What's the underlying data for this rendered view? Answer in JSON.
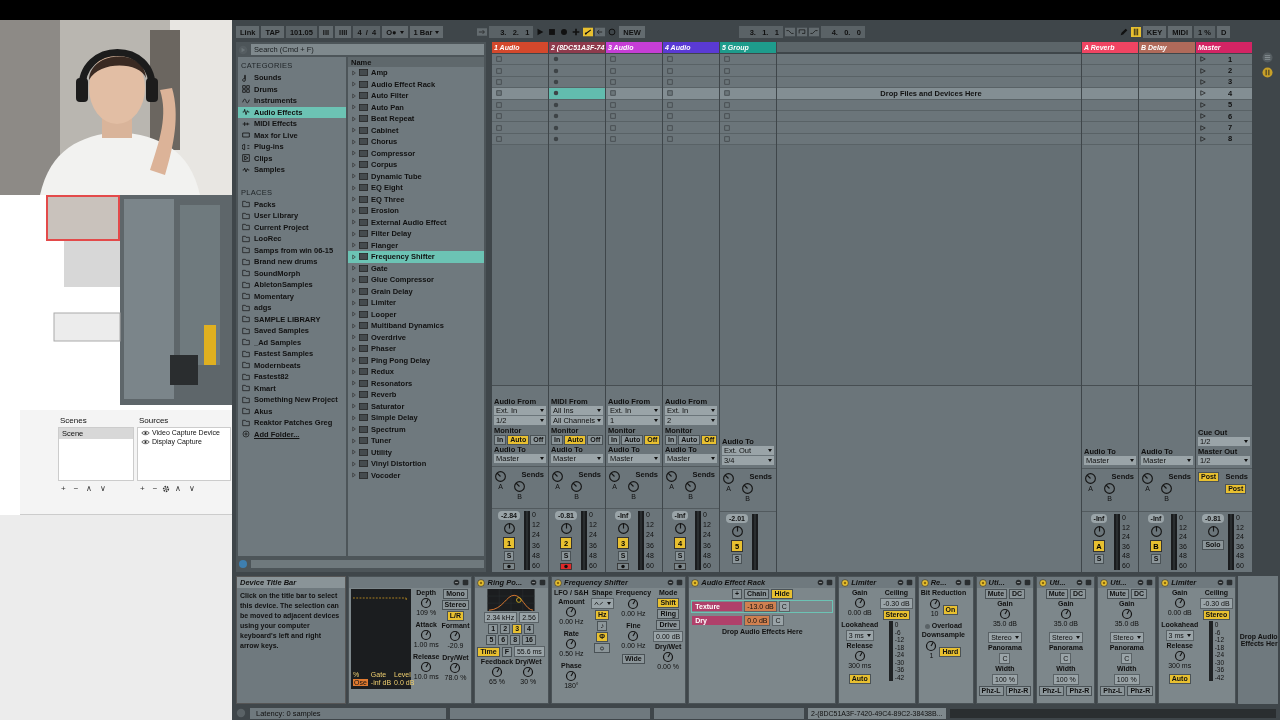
{
  "obs": {
    "scenes_title": "Scenes",
    "sources_title": "Sources",
    "scenes": [
      {
        "label": "Scene",
        "selected": true
      }
    ],
    "sources": [
      {
        "label": "Video Capture Device",
        "visible": true
      },
      {
        "label": "Display Capture",
        "visible": true
      }
    ],
    "scene_buttons": [
      "+",
      "−",
      "∧",
      "∨"
    ],
    "source_buttons": [
      "+",
      "−",
      "∧",
      "∨"
    ]
  },
  "top_bar": {
    "left": [
      {
        "kind": "button",
        "label": "Link"
      },
      {
        "kind": "button",
        "label": "TAP"
      },
      {
        "kind": "display",
        "label": "101.05"
      },
      {
        "kind": "button",
        "label": "III"
      },
      {
        "kind": "button",
        "label": "IIII"
      },
      {
        "kind": "display",
        "label": "4  /  4"
      },
      {
        "kind": "dropdown",
        "label": "O●"
      },
      {
        "kind": "dropdown",
        "label": "1 Bar"
      }
    ],
    "position": "3.   2.   1",
    "automation_arm": true,
    "new": "NEW",
    "loop_start": "3.   1.   1",
    "loop_length": "4.   0.   0",
    "keys_on": true,
    "right": [
      {
        "kind": "button",
        "label": "KEY"
      },
      {
        "kind": "button",
        "label": "MIDI"
      },
      {
        "kind": "display",
        "label": "1 %"
      },
      {
        "kind": "button",
        "label": "D"
      }
    ]
  },
  "browser": {
    "search": {
      "placeholder": "Search (Cmd + F)"
    },
    "categories_title": "CATEGORIES",
    "categories": [
      {
        "label": "Sounds",
        "selected": false
      },
      {
        "label": "Drums",
        "selected": false
      },
      {
        "label": "Instruments",
        "selected": false
      },
      {
        "label": "Audio Effects",
        "selected": true
      },
      {
        "label": "MIDI Effects",
        "selected": false
      },
      {
        "label": "Max for Live",
        "selected": false
      },
      {
        "label": "Plug-ins",
        "selected": false
      },
      {
        "label": "Clips",
        "selected": false
      },
      {
        "label": "Samples",
        "selected": false
      }
    ],
    "places_title": "PLACES",
    "places": [
      "Packs",
      "User Library",
      "Current Project",
      "LooRec",
      "Samps from win 06-15",
      "Brand new drums",
      "SoundMorph",
      "AbletonSamples",
      "Momentary",
      "adgs",
      "SAMPLE LIBRARY",
      "Saved Samples",
      "_Ad Samples",
      "Fastest Samples",
      "Modernbeats",
      "Fastest82",
      "Kmart",
      "Something New Project",
      "Akus",
      "Reaktor Patches Greg"
    ],
    "add_folder": "Add Folder...",
    "column": "Name",
    "items": [
      {
        "label": "Amp",
        "selected": false
      },
      {
        "label": "Audio Effect Rack",
        "selected": false
      },
      {
        "label": "Auto Filter",
        "selected": false
      },
      {
        "label": "Auto Pan",
        "selected": false
      },
      {
        "label": "Beat Repeat",
        "selected": false
      },
      {
        "label": "Cabinet",
        "selected": false
      },
      {
        "label": "Chorus",
        "selected": false
      },
      {
        "label": "Compressor",
        "selected": false
      },
      {
        "label": "Corpus",
        "selected": false
      },
      {
        "label": "Dynamic Tube",
        "selected": false
      },
      {
        "label": "EQ Eight",
        "selected": false
      },
      {
        "label": "EQ Three",
        "selected": false
      },
      {
        "label": "Erosion",
        "selected": false
      },
      {
        "label": "External Audio Effect",
        "selected": false
      },
      {
        "label": "Filter Delay",
        "selected": false
      },
      {
        "label": "Flanger",
        "selected": false
      },
      {
        "label": "Frequency Shifter",
        "selected": true
      },
      {
        "label": "Gate",
        "selected": false
      },
      {
        "label": "Glue Compressor",
        "selected": false
      },
      {
        "label": "Grain Delay",
        "selected": false
      },
      {
        "label": "Limiter",
        "selected": false
      },
      {
        "label": "Looper",
        "selected": false
      },
      {
        "label": "Multiband Dynamics",
        "selected": false
      },
      {
        "label": "Overdrive",
        "selected": false
      },
      {
        "label": "Phaser",
        "selected": false
      },
      {
        "label": "Ping Pong Delay",
        "selected": false
      },
      {
        "label": "Redux",
        "selected": false
      },
      {
        "label": "Resonators",
        "selected": false
      },
      {
        "label": "Reverb",
        "selected": false
      },
      {
        "label": "Saturator",
        "selected": false
      },
      {
        "label": "Simple Delay",
        "selected": false
      },
      {
        "label": "Spectrum",
        "selected": false
      },
      {
        "label": "Tuner",
        "selected": false
      },
      {
        "label": "Utility",
        "selected": false
      },
      {
        "label": "Vinyl Distortion",
        "selected": false
      },
      {
        "label": "Vocoder",
        "selected": false
      }
    ]
  },
  "session": {
    "drop_hint": "Drop Files and Devices Here",
    "tracks": [
      {
        "name": "1 Audio",
        "color": "#d4482c",
        "kind": "audio",
        "armed": false,
        "focused": false,
        "routing": [
          {
            "kind": "dropdown",
            "label": "Audio From",
            "value": "Ext. In",
            "channel": "1/2"
          },
          {
            "kind": "monitor",
            "label": "Monitor",
            "options": [
              {
                "label": "In",
                "on": false
              },
              {
                "label": "Auto",
                "on": true
              },
              {
                "label": "Off",
                "on": false
              }
            ]
          },
          {
            "kind": "dropdown",
            "label": "Audio To",
            "value": "Master"
          }
        ],
        "sends": {
          "label": "Sends",
          "knobs": [
            "A",
            "B"
          ]
        },
        "volume": "-2.84",
        "number": "1",
        "active": true,
        "solo": "S",
        "arm": false,
        "scale": [
          "0",
          "12",
          "24",
          "36",
          "48",
          "60"
        ]
      },
      {
        "name": "2 (8DC51A3F-74",
        "color": "#8e3a4c",
        "kind": "midi",
        "armed": true,
        "focused": true,
        "routing": [
          {
            "kind": "dropdown",
            "label": "MIDI From",
            "value": "All Ins",
            "channel": "All Channels"
          },
          {
            "kind": "monitor",
            "label": "Monitor",
            "options": [
              {
                "label": "In",
                "on": false
              },
              {
                "label": "Auto",
                "on": true
              },
              {
                "label": "Off",
                "on": false
              }
            ]
          },
          {
            "kind": "dropdown",
            "label": "Audio To",
            "value": "Master"
          }
        ],
        "sends": {
          "label": "Sends",
          "knobs": [
            "A",
            "B"
          ]
        },
        "volume": "-0.81",
        "number": "2",
        "active": true,
        "solo": "S",
        "arm": true,
        "scale": [
          "0",
          "12",
          "24",
          "36",
          "48",
          "60"
        ]
      },
      {
        "name": "3 Audio",
        "color": "#c63ed6",
        "kind": "audio",
        "armed": false,
        "focused": false,
        "routing": [
          {
            "kind": "dropdown",
            "label": "Audio From",
            "value": "Ext. In",
            "channel": "1"
          },
          {
            "kind": "monitor",
            "label": "Monitor",
            "options": [
              {
                "label": "In",
                "on": false
              },
              {
                "label": "Auto",
                "on": false
              },
              {
                "label": "Off",
                "on": true
              }
            ]
          },
          {
            "kind": "dropdown",
            "label": "Audio To",
            "value": "Master"
          }
        ],
        "sends": {
          "label": "Sends",
          "knobs": [
            "A",
            "B"
          ]
        },
        "volume": "-Inf",
        "number": "3",
        "active": true,
        "solo": "S",
        "arm": false,
        "scale": [
          "0",
          "12",
          "24",
          "36",
          "48",
          "60"
        ]
      },
      {
        "name": "4 Audio",
        "color": "#5a3ad4",
        "kind": "audio",
        "armed": false,
        "focused": false,
        "routing": [
          {
            "kind": "dropdown",
            "label": "Audio From",
            "value": "Ext. In",
            "channel": "2"
          },
          {
            "kind": "monitor",
            "label": "Monitor",
            "options": [
              {
                "label": "In",
                "on": false
              },
              {
                "label": "Auto",
                "on": false
              },
              {
                "label": "Off",
                "on": true
              }
            ]
          },
          {
            "kind": "dropdown",
            "label": "Audio To",
            "value": "Master"
          }
        ],
        "sends": {
          "label": "Sends",
          "knobs": [
            "A",
            "B"
          ]
        },
        "volume": "-Inf",
        "number": "4",
        "active": true,
        "solo": "S",
        "arm": false,
        "scale": [
          "0",
          "12",
          "24",
          "36",
          "48",
          "60"
        ]
      },
      {
        "name": "5 Group",
        "color": "#1e9c8c",
        "kind": "group",
        "armed": false,
        "focused": false,
        "routing": [
          {
            "kind": "dropdown",
            "label": "Audio To",
            "value": "Ext. Out",
            "channel": "3/4"
          }
        ],
        "sends": {
          "label": "Sends",
          "knobs": [
            "A",
            "B"
          ]
        },
        "volume": "-2.01",
        "number": "5",
        "active": true,
        "solo": "S"
      },
      {
        "name": "A Reverb",
        "color": "#f04462",
        "kind": "return",
        "routing": [
          {
            "kind": "dropdown",
            "label": "Audio To",
            "value": "Master"
          }
        ],
        "sends": {
          "label": "Sends",
          "knobs": [
            "A",
            "B"
          ]
        },
        "volume": "-Inf",
        "number": "A",
        "active": true,
        "solo": "S",
        "scale": [
          "0",
          "12",
          "24",
          "36",
          "48",
          "60"
        ]
      },
      {
        "name": "B Delay",
        "color": "#b06a5a",
        "kind": "return",
        "routing": [
          {
            "kind": "dropdown",
            "label": "Audio To",
            "value": "Master"
          }
        ],
        "sends": {
          "label": "Sends",
          "knobs": [
            "A",
            "B"
          ]
        },
        "volume": "-Inf",
        "number": "B",
        "active": true,
        "solo": "S",
        "scale": [
          "0",
          "12",
          "24",
          "36",
          "48",
          "60"
        ]
      },
      {
        "name": "Master",
        "color": "#d42464",
        "kind": "master",
        "routing": [
          {
            "kind": "dropdown",
            "label": "Cue Out",
            "value": "1/2"
          },
          {
            "kind": "dropdown",
            "label": "Master Out",
            "value": "1/2"
          }
        ],
        "sends": {
          "label": "Sends",
          "post": [
            {
              "label": "Post",
              "on": true
            },
            {
              "label": "Post",
              "on": true
            }
          ]
        },
        "volume": "-0.81",
        "solo": "Solo",
        "scale": [
          "0",
          "12",
          "24",
          "36",
          "48",
          "60"
        ],
        "scenes": [
          {
            "label": "1",
            "selected": false
          },
          {
            "label": "2",
            "selected": false
          },
          {
            "label": "3",
            "selected": false
          },
          {
            "label": "4",
            "selected": true
          },
          {
            "label": "5",
            "selected": false
          },
          {
            "label": "6",
            "selected": false
          },
          {
            "label": "7",
            "selected": false
          },
          {
            "label": "8",
            "selected": false
          }
        ]
      }
    ]
  },
  "devices": [
    {
      "kind": "info",
      "title": "Device Title Bar",
      "text": "Click on the title bar to select this device. The selection can be moved to adjacent devices using your computer keyboard's left and right arrow keys."
    },
    {
      "kind": "device",
      "columns": [
        [
          {
            "kind": "screen",
            "texts": [
              {
                "kind": "plain",
                "label": "%"
              },
              {
                "kind": "plain",
                "label": "Gate"
              },
              {
                "kind": "plain",
                "label": "Level"
              },
              {
                "kind": "accent",
                "label": "Ose"
              },
              {
                "kind": "plain",
                "label": "-inf dB"
              },
              {
                "kind": "plain",
                "label": "0.0 dB"
              }
            ]
          }
        ],
        [
          {
            "kind": "knob",
            "label": "Depth",
            "value": "109 %"
          },
          {
            "kind": "knob",
            "label": "Attack",
            "value": "1.00 ms"
          },
          {
            "kind": "knob",
            "label": "Release",
            "value": "10.0 ms"
          }
        ],
        [
          {
            "kind": "button",
            "label": "Mono",
            "on": false
          },
          {
            "kind": "button",
            "label": "Stereo",
            "on": false
          },
          {
            "kind": "button",
            "label": "L/R",
            "on": true
          },
          {
            "kind": "knob",
            "label": "Formant",
            "value": "-20.9"
          },
          {
            "kind": "knob",
            "label": "Dry/Wet",
            "value": "78.0 %"
          }
        ]
      ]
    },
    {
      "kind": "device",
      "title": "Ring Po...",
      "on": true,
      "columns": [
        [
          {
            "kind": "filter-screen"
          },
          {
            "kind": "row",
            "items": [
              {
                "kind": "value",
                "value": "2.34 kHz"
              },
              {
                "kind": "value",
                "value": "2.56"
              }
            ]
          },
          {
            "kind": "row",
            "items": [
              {
                "kind": "button",
                "label": "1",
                "on": false
              },
              {
                "kind": "button",
                "label": "2",
                "on": false
              },
              {
                "kind": "button",
                "label": "3",
                "on": true
              },
              {
                "kind": "button",
                "label": "4",
                "on": false
              }
            ]
          },
          {
            "kind": "row",
            "items": [
              {
                "kind": "button",
                "label": "5",
                "on": false
              },
              {
                "kind": "button",
                "label": "6",
                "on": false
              },
              {
                "kind": "button",
                "label": "8",
                "on": false
              },
              {
                "kind": "button",
                "label": "16",
                "on": false
              }
            ]
          },
          {
            "kind": "row",
            "items": [
              {
                "kind": "button",
                "label": "Time",
                "on": true
              },
              {
                "kind": "button",
                "label": "F",
                "on": false
              },
              {
                "kind": "value",
                "value": "55.6 ms"
              }
            ]
          },
          {
            "kind": "row",
            "items": [
              {
                "kind": "knob",
                "label": "Feedback",
                "value": "65 %"
              },
              {
                "kind": "knob",
                "label": "Dry/Wet",
                "value": "30 %"
              }
            ]
          }
        ]
      ]
    },
    {
      "kind": "device",
      "title": "Frequency Shifter",
      "on": true,
      "columns": [
        [
          {
            "kind": "text",
            "label": "LFO / S&H"
          },
          {
            "kind": "knob",
            "label": "Amount",
            "value": "0.00 Hz"
          },
          {
            "kind": "knob",
            "label": "Rate",
            "value": "0.50 Hz"
          },
          {
            "kind": "knob",
            "label": "Phase",
            "value": "180°"
          }
        ],
        [
          {
            "kind": "text",
            "label": "Shape"
          },
          {
            "kind": "wave-dropdown"
          },
          {
            "kind": "button",
            "label": "Hz",
            "on": true
          },
          {
            "kind": "button",
            "label": "♪",
            "on": false
          },
          {
            "kind": "button",
            "label": "Φ",
            "on": true
          },
          {
            "kind": "icon-button"
          }
        ],
        [
          {
            "kind": "text",
            "label": "Frequency"
          },
          {
            "kind": "knob",
            "value": "0.00 Hz"
          },
          {
            "kind": "knob",
            "label": "Fine",
            "value": "0.00 Hz"
          },
          {
            "kind": "button",
            "label": "Wide",
            "on": false
          }
        ],
        [
          {
            "kind": "text",
            "label": "Mode"
          },
          {
            "kind": "button",
            "label": "Shift",
            "on": true
          },
          {
            "kind": "button",
            "label": "Ring",
            "on": false
          },
          {
            "kind": "button",
            "label": "Drive",
            "on": false
          },
          {
            "kind": "value",
            "value": "0.00 dB"
          },
          {
            "kind": "knob",
            "label": "Dry/Wet",
            "value": "0.00 %"
          }
        ]
      ]
    },
    {
      "kind": "device",
      "title": "Audio Effect Rack",
      "on": true,
      "columns": [
        [
          {
            "kind": "row",
            "items": [
              {
                "kind": "button",
                "label": "+",
                "on": false
              },
              {
                "kind": "button",
                "label": "Chain",
                "on": false
              },
              {
                "kind": "button",
                "label": "Hide",
                "on": true
              }
            ]
          },
          {
            "kind": "chain",
            "label": "Texture",
            "volume": "-13.0 dB",
            "pan": "C",
            "selected": true
          },
          {
            "kind": "chain",
            "label": "Dry",
            "volume": "0.0 dB",
            "pan": "C",
            "selected": false
          },
          {
            "kind": "text",
            "label": "Drop Audio Effects Here"
          }
        ]
      ]
    },
    {
      "kind": "device",
      "title": "Limiter",
      "on": true,
      "columns": [
        [
          {
            "kind": "knob",
            "label": "Gain",
            "value": "0.00 dB"
          },
          {
            "kind": "text",
            "label": "Lookahead"
          },
          {
            "kind": "dropdown",
            "value": "3 ms"
          },
          {
            "kind": "knob",
            "label": "Release",
            "value": "300 ms"
          },
          {
            "kind": "button",
            "label": "Auto",
            "on": true
          }
        ],
        [
          {
            "kind": "text",
            "label": "Ceiling"
          },
          {
            "kind": "value",
            "value": "-0.30 dB"
          },
          {
            "kind": "button",
            "label": "Stereo",
            "on": true
          },
          {
            "kind": "meter",
            "scale": [
              "0",
              "-6",
              "-12",
              "-18",
              "-24",
              "-30",
              "-36",
              "-42"
            ]
          }
        ]
      ]
    },
    {
      "kind": "device",
      "title": "Re...",
      "on": true,
      "columns": [
        [
          {
            "kind": "text",
            "label": "Bit Reduction"
          },
          {
            "kind": "row",
            "items": [
              {
                "kind": "knob",
                "value": "10"
              },
              {
                "kind": "button",
                "label": "On",
                "on": true
              }
            ]
          },
          {
            "kind": "indicator",
            "label": "Overload",
            "on": false
          },
          {
            "kind": "text",
            "label": "Downsample"
          },
          {
            "kind": "row",
            "items": [
              {
                "kind": "knob",
                "value": "1"
              },
              {
                "kind": "button",
                "label": "Hard",
                "on": true
              }
            ]
          }
        ]
      ]
    },
    {
      "kind": "device",
      "title": "Uti...",
      "on": true,
      "columns": [
        [
          {
            "kind": "row",
            "items": [
              {
                "kind": "button",
                "label": "Mute",
                "on": false
              },
              {
                "kind": "button",
                "label": "DC",
                "on": false
              }
            ]
          },
          {
            "kind": "knob",
            "label": "Gain",
            "value": "35.0 dB"
          },
          {
            "kind": "dropdown",
            "value": "Stereo"
          },
          {
            "kind": "text",
            "label": "Panorama"
          },
          {
            "kind": "value",
            "value": "C"
          },
          {
            "kind": "text",
            "label": "Width"
          },
          {
            "kind": "value",
            "value": "100 %"
          },
          {
            "kind": "row",
            "items": [
              {
                "kind": "button",
                "label": "Phz-L",
                "on": false
              },
              {
                "kind": "button",
                "label": "Phz-R",
                "on": false
              }
            ]
          }
        ]
      ]
    },
    {
      "kind": "device",
      "title": "Uti...",
      "on": true,
      "columns": [
        [
          {
            "kind": "row",
            "items": [
              {
                "kind": "button",
                "label": "Mute",
                "on": false
              },
              {
                "kind": "button",
                "label": "DC",
                "on": false
              }
            ]
          },
          {
            "kind": "knob",
            "label": "Gain",
            "value": "35.0 dB"
          },
          {
            "kind": "dropdown",
            "value": "Stereo"
          },
          {
            "kind": "text",
            "label": "Panorama"
          },
          {
            "kind": "value",
            "value": "C"
          },
          {
            "kind": "text",
            "label": "Width"
          },
          {
            "kind": "value",
            "value": "100 %"
          },
          {
            "kind": "row",
            "items": [
              {
                "kind": "button",
                "label": "Phz-L",
                "on": false
              },
              {
                "kind": "button",
                "label": "Phz-R",
                "on": false
              }
            ]
          }
        ]
      ]
    },
    {
      "kind": "device",
      "title": "Uti...",
      "on": true,
      "columns": [
        [
          {
            "kind": "row",
            "items": [
              {
                "kind": "button",
                "label": "Mute",
                "on": false
              },
              {
                "kind": "button",
                "label": "DC",
                "on": false
              }
            ]
          },
          {
            "kind": "knob",
            "label": "Gain",
            "value": "35.0 dB"
          },
          {
            "kind": "dropdown",
            "value": "Stereo"
          },
          {
            "kind": "text",
            "label": "Panorama"
          },
          {
            "kind": "value",
            "value": "C"
          },
          {
            "kind": "text",
            "label": "Width"
          },
          {
            "kind": "value",
            "value": "100 %"
          },
          {
            "kind": "row",
            "items": [
              {
                "kind": "button",
                "label": "Phz-L",
                "on": false
              },
              {
                "kind": "button",
                "label": "Phz-R",
                "on": false
              }
            ]
          }
        ]
      ]
    },
    {
      "kind": "device",
      "title": "Limiter",
      "on": true,
      "columns": [
        [
          {
            "kind": "knob",
            "label": "Gain",
            "value": "0.00 dB"
          },
          {
            "kind": "text",
            "label": "Lookahead"
          },
          {
            "kind": "dropdown",
            "value": "3 ms"
          },
          {
            "kind": "knob",
            "label": "Release",
            "value": "300 ms"
          },
          {
            "kind": "button",
            "label": "Auto",
            "on": true
          }
        ],
        [
          {
            "kind": "text",
            "label": "Ceiling"
          },
          {
            "kind": "value",
            "value": "-0.30 dB"
          },
          {
            "kind": "button",
            "label": "Stereo",
            "on": true
          },
          {
            "kind": "meter",
            "scale": [
              "0",
              "-6",
              "-12",
              "-18",
              "-24",
              "-30",
              "-36",
              "-42"
            ]
          }
        ]
      ]
    },
    {
      "kind": "drop",
      "lines": [
        "Drop Audio",
        "Effects Her"
      ]
    }
  ],
  "status_bar": {
    "latency": "Latency: 0 samples",
    "clip": "2-(8DC51A3F-7420-49C4-89C2-38438B..."
  }
}
